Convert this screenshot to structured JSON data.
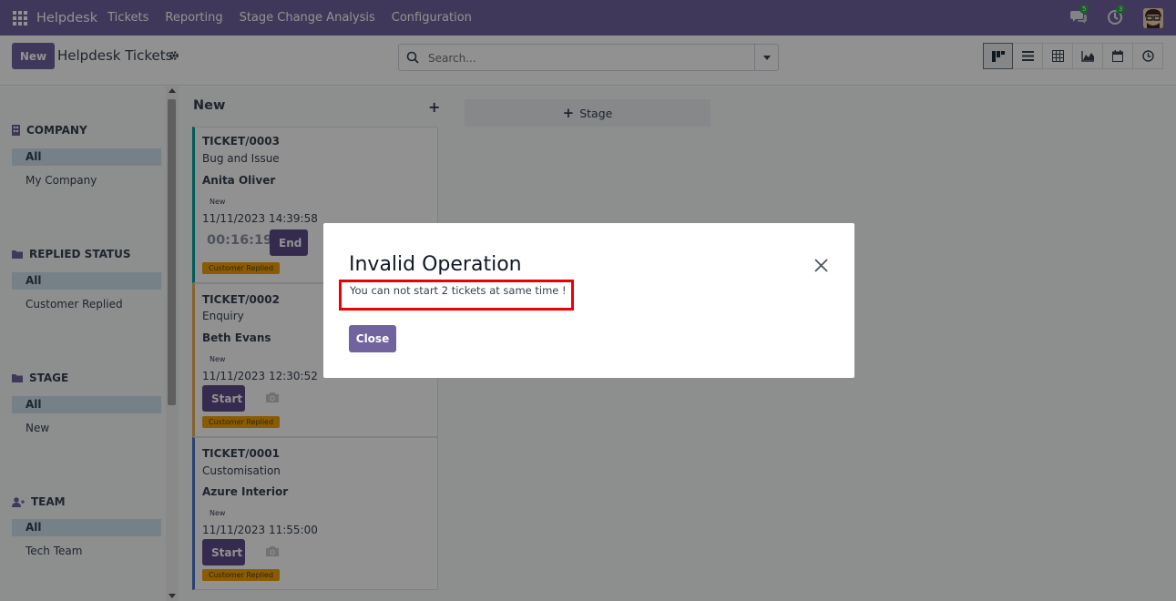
{
  "navbar": {
    "brand": "Helpdesk",
    "menu": [
      "Tickets",
      "Reporting",
      "Stage Change Analysis",
      "Configuration"
    ],
    "messages_count": "5",
    "activities_count": "3"
  },
  "control_panel": {
    "new_label": "New",
    "title": "Helpdesk Tickets",
    "search_placeholder": "Search..."
  },
  "sidebar": {
    "sections": [
      {
        "title": "COMPANY",
        "items": [
          "All",
          "My Company"
        ]
      },
      {
        "title": "REPLIED STATUS",
        "items": [
          "All",
          "Customer Replied"
        ]
      },
      {
        "title": "STAGE",
        "items": [
          "All",
          "New"
        ]
      },
      {
        "title": "TEAM",
        "items": [
          "All",
          "Tech Team"
        ]
      }
    ]
  },
  "kanban": {
    "column_title": "New",
    "add_stage_label": "Stage",
    "cards": [
      {
        "name": "TICKET/0003",
        "subject": "Bug and Issue",
        "customer": "Anita Oliver",
        "stage": "New",
        "date": "11/11/2023 14:39:58",
        "timer": "00:16:19",
        "button": "End",
        "tag": "Customer Replied"
      },
      {
        "name": "TICKET/0002",
        "subject": "Enquiry",
        "customer": "Beth Evans",
        "stage": "New",
        "date": "11/11/2023 12:30:52",
        "button": "Start",
        "tag": "Customer Replied"
      },
      {
        "name": "TICKET/0001",
        "subject": "Customisation",
        "customer": "Azure Interior",
        "stage": "New",
        "date": "11/11/2023 11:55:00",
        "button": "Start",
        "tag": "Customer Replied"
      }
    ]
  },
  "dialog": {
    "title": "Invalid Operation",
    "message": "You can not start 2 tickets at same time !",
    "close_label": "Close"
  }
}
